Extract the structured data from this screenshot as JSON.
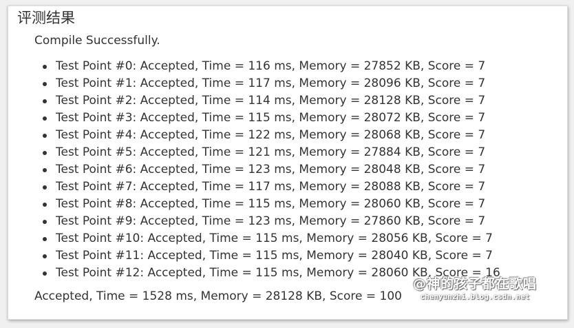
{
  "panel": {
    "title": "评测结果",
    "compile_status": "Compile Successfully.",
    "test_points": [
      "Test Point #0: Accepted, Time = 116 ms, Memory = 27852 KB, Score = 7",
      "Test Point #1: Accepted, Time = 117 ms, Memory = 28096 KB, Score = 7",
      "Test Point #2: Accepted, Time = 114 ms, Memory = 28128 KB, Score = 7",
      "Test Point #3: Accepted, Time = 115 ms, Memory = 28072 KB, Score = 7",
      "Test Point #4: Accepted, Time = 122 ms, Memory = 28068 KB, Score = 7",
      "Test Point #5: Accepted, Time = 121 ms, Memory = 27884 KB, Score = 7",
      "Test Point #6: Accepted, Time = 123 ms, Memory = 28048 KB, Score = 7",
      "Test Point #7: Accepted, Time = 117 ms, Memory = 28088 KB, Score = 7",
      "Test Point #8: Accepted, Time = 115 ms, Memory = 28060 KB, Score = 7",
      "Test Point #9: Accepted, Time = 123 ms, Memory = 27860 KB, Score = 7",
      "Test Point #10: Accepted, Time = 115 ms, Memory = 28056 KB, Score = 7",
      "Test Point #11: Accepted, Time = 115 ms, Memory = 28040 KB, Score = 7",
      "Test Point #12: Accepted, Time = 115 ms, Memory = 28060 KB, Score = 16"
    ],
    "summary": "Accepted, Time = 1528 ms, Memory = 28128 KB, Score = 100"
  },
  "watermark": {
    "name": "@神的孩子都在歌唱",
    "url": "chenyunzhi.blog.csdn.net"
  }
}
